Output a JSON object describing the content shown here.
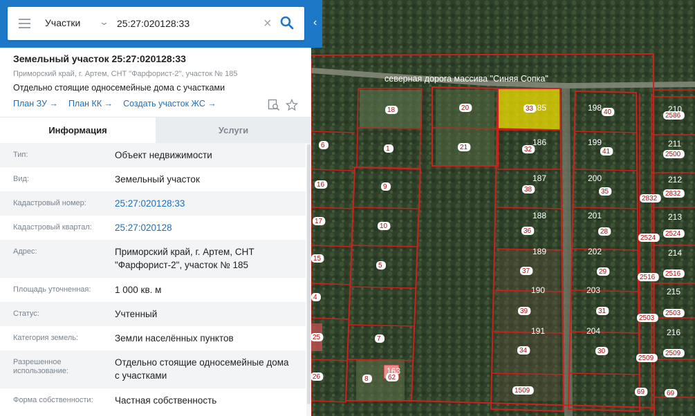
{
  "search": {
    "type_label": "Участки",
    "query": "25:27:020128:33"
  },
  "card": {
    "title": "Земельный участок 25:27:020128:33",
    "address": "Приморский край, г. Артем, СНТ \"Фарфорист-2\", участок № 185",
    "usage": "Отдельно стоящие односемейные дома с участками",
    "links": [
      "План ЗУ →",
      "План КК →",
      "Создать участок ЖС →"
    ]
  },
  "tabs": {
    "info": "Информация",
    "services": "Услуги"
  },
  "props": [
    {
      "k": "Тип:",
      "v": "Объект недвижимости",
      "link": false
    },
    {
      "k": "Вид:",
      "v": "Земельный участок",
      "link": false
    },
    {
      "k": "Кадастровый номер:",
      "v": "25:27:020128:33",
      "link": true
    },
    {
      "k": "Кадастровый квартал:",
      "v": "25:27:020128",
      "link": true
    },
    {
      "k": "Адрес:",
      "v": "Приморский край, г. Артем, СНТ \"Фарфорист-2\", участок № 185",
      "link": false
    },
    {
      "k": "Площадь уточненная:",
      "v": "1 000 кв. м",
      "link": false
    },
    {
      "k": "Статус:",
      "v": "Учтенный",
      "link": false
    },
    {
      "k": "Категория земель:",
      "v": "Земли населённых пунктов",
      "link": false
    },
    {
      "k": "Разрешенное использование:",
      "v": "Отдельно стоящие односемейные дома с участками",
      "link": false
    },
    {
      "k": "Форма собственности:",
      "v": "Частная собственность",
      "link": false
    }
  ],
  "map": {
    "road_label": "северная дорога массива \"Синяя Сопка\"",
    "parcel_numbers": [
      "185",
      "186",
      "187",
      "188",
      "189",
      "190",
      "191",
      "198",
      "199",
      "200",
      "201",
      "202",
      "203",
      "204",
      "210",
      "211",
      "212",
      "213",
      "214",
      "215",
      "216",
      "163"
    ],
    "lot_labels": [
      "18",
      "20",
      "21",
      "1",
      "6",
      "9",
      "10",
      "5",
      "7",
      "8",
      "16",
      "17",
      "15",
      "4",
      "25",
      "26",
      "32",
      "38",
      "36",
      "37",
      "39",
      "34",
      "1509",
      "40",
      "41",
      "35",
      "28",
      "29",
      "31",
      "30",
      "2832",
      "2524",
      "2516",
      "2503",
      "2509",
      "2586",
      "2500",
      "2832",
      "2524",
      "2516",
      "2503",
      "2509",
      "69",
      "69",
      "33",
      "62"
    ]
  },
  "colors": {
    "brand": "#1e78c8",
    "link": "#1e6fb8",
    "parcel_border": "#d0201c",
    "selected_fill": "#f2e000"
  }
}
